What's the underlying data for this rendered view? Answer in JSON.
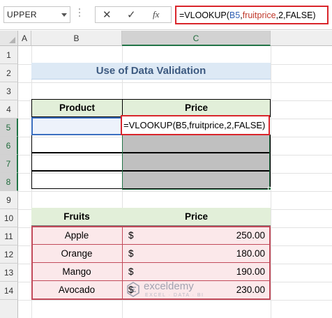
{
  "formula_bar": {
    "name_box": "UPPER",
    "cancel_glyph": "✕",
    "enter_glyph": "✓",
    "fx_label": "fx",
    "formula_prefix": "=VLOOKUP(",
    "formula_ref1": "B5",
    "formula_sep1": ",",
    "formula_ref2": "fruitprice",
    "formula_suffix": ",2,FALSE)"
  },
  "columns": [
    "A",
    "B",
    "C"
  ],
  "rows": [
    "1",
    "2",
    "3",
    "4",
    "5",
    "6",
    "7",
    "8",
    "9",
    "10",
    "11",
    "12",
    "13",
    "14"
  ],
  "sheet": {
    "title": "Use of Data Validation",
    "table1": {
      "headers": [
        "Product",
        "Price"
      ],
      "edit_text": "=VLOOKUP(B5,fruitprice,2,FALSE)"
    },
    "table2": {
      "headers": [
        "Fruits",
        "Price"
      ],
      "rows": [
        {
          "fruit": "Apple",
          "currency": "$",
          "amount": "250.00"
        },
        {
          "fruit": "Orange",
          "currency": "$",
          "amount": "180.00"
        },
        {
          "fruit": "Mango",
          "currency": "$",
          "amount": "190.00"
        },
        {
          "fruit": "Avocado",
          "currency": "$",
          "amount": "230.00"
        }
      ]
    }
  },
  "watermark": {
    "brand": "exceldemy",
    "tagline": "EXCEL · DATA · BI"
  },
  "colors": {
    "highlight_red": "#d9252b",
    "header_green": "#e2efd9",
    "title_blue": "#dde9f5",
    "gray_fill": "#c0c0c0",
    "pink_fill": "#fbe8ea",
    "selection_green": "#217346"
  }
}
